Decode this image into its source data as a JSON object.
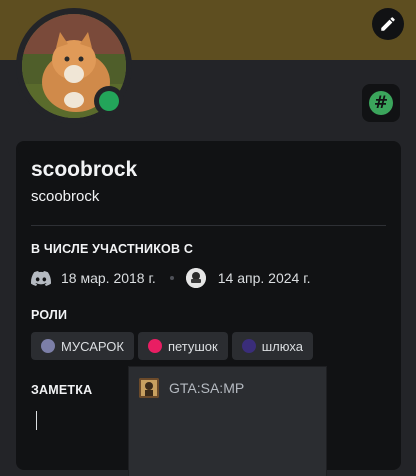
{
  "profile": {
    "display_name": "scoobrock",
    "username": "scoobrock",
    "status_color": "#23a55a",
    "banner_color": "#5e4e20",
    "avatar_icon": "cat-avatar"
  },
  "member_since": {
    "title": "В ЧИСЛЕ УЧАСТНИКОВ С",
    "discord_date": "18 мар. 2018 г.",
    "server_date": "14 апр. 2024 г."
  },
  "roles": {
    "title": "РОЛИ",
    "items": [
      {
        "label": "МУСАРОК",
        "color": "#7c7fa8"
      },
      {
        "label": "петушок",
        "color": "#e91e63"
      },
      {
        "label": "шлюха",
        "color": "#3a2d7a"
      }
    ]
  },
  "note": {
    "title": "ЗАМЕТКА"
  },
  "popup": {
    "item_label": "GTA:SA:MP"
  }
}
